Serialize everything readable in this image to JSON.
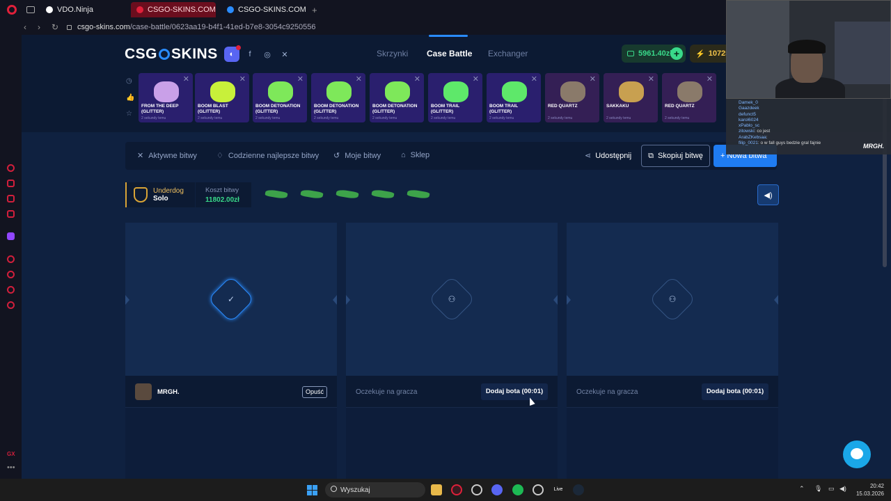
{
  "browser": {
    "tabs": [
      {
        "label": "VDO.Ninja",
        "active": false
      },
      {
        "label": "CSGO-SKINS.COM - Najle",
        "active": true
      },
      {
        "label": "CSGO-SKINS.COM - Najle",
        "active": false
      }
    ],
    "url_host": "csgo-skins.com",
    "url_path": "/case-battle/0623aa19-b4f1-41ed-b7e8-3054c9250556"
  },
  "header": {
    "logo_left": "CSG",
    "logo_right": "SKINS",
    "nav": [
      {
        "label": "Skrzynki",
        "active": false
      },
      {
        "label": "Case Battle",
        "active": true
      },
      {
        "label": "Exchanger",
        "active": false
      }
    ],
    "balance": "5961.40zł",
    "coins": "10725"
  },
  "live_drops": [
    {
      "name": "FROM THE DEEP (GLITTER)",
      "time": "2 sekundy temu",
      "color": "#c9a0e8"
    },
    {
      "name": "BOOM BLAST (GLITTER)",
      "time": "2 sekundy temu",
      "color": "#c8f03a"
    },
    {
      "name": "BOOM DETONATION (GLITTER)",
      "time": "2 sekundy temu",
      "color": "#7ee85a"
    },
    {
      "name": "BOOM DETONATION (GLITTER)",
      "time": "2 sekundy temu",
      "color": "#7ee85a"
    },
    {
      "name": "BOOM DETONATION (GLITTER)",
      "time": "2 sekundy temu",
      "color": "#7ee85a"
    },
    {
      "name": "BOOM TRAIL (GLITTER)",
      "time": "2 sekundy temu",
      "color": "#5ee86a"
    },
    {
      "name": "BOOM TRAIL (GLITTER)",
      "time": "2 sekundy temu",
      "color": "#5ee86a"
    },
    {
      "name": "RED QUARTZ",
      "time": "2 sekundy temu",
      "color": "#8a7a6a"
    },
    {
      "name": "SAKKAKU",
      "time": "2 sekundy temu",
      "color": "#c8a050"
    },
    {
      "name": "RED QUARTZ",
      "time": "2 sekundy temu",
      "color": "#8a7a6a"
    }
  ],
  "chat": {
    "lines": [
      {
        "user": "Damek_0",
        "text": ""
      },
      {
        "user": "Gaazdeek",
        "text": ""
      },
      {
        "user": "defunct5",
        "text": ""
      },
      {
        "user": "karol6024",
        "text": ""
      },
      {
        "user": "xPablo_sc",
        "text": ""
      },
      {
        "user": "zitowski",
        "text": ": co jest"
      },
      {
        "user": "ArabZKebsaa",
        "text": ":"
      },
      {
        "user": "filip_0021",
        "text": ": o w fall guys bedzie gral fajnie"
      }
    ],
    "brand": "MRGH."
  },
  "subnav": {
    "items": [
      "Aktywne bitwy",
      "Codzienne najlepsze bitwy",
      "Moje bitwy",
      "Sklep"
    ],
    "share": "Udostępnij",
    "copy": "Skopiuj bitwę",
    "new": "+ Nowa bitwa"
  },
  "battle": {
    "mode": "Underdog",
    "type": "Solo",
    "cost_label": "Koszt bitwy",
    "cost": "11802.00zł",
    "case_count": 5
  },
  "slots": [
    {
      "state": "player",
      "player": "MRGH.",
      "action": "Opuść"
    },
    {
      "state": "waiting",
      "text": "Oczekuje na gracza",
      "action": "Dodaj bota (00:01)"
    },
    {
      "state": "waiting",
      "text": "Oczekuje na gracza",
      "action": "Dodaj bota (00:01)"
    }
  ],
  "taskbar": {
    "search": "Wyszukaj",
    "time": "20:42",
    "date": "15.03.2026"
  }
}
